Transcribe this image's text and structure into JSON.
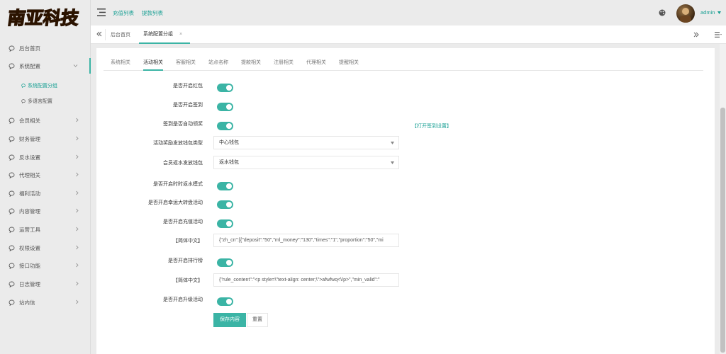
{
  "brand": {
    "logo_text": "南亚科技"
  },
  "sidebar": {
    "items": [
      {
        "label": "后台首页",
        "icon": "chat-bubble-icon"
      },
      {
        "label": "系统配置",
        "icon": "chat-bubble-icon"
      },
      {
        "label": "会员相关",
        "icon": "chat-bubble-icon"
      },
      {
        "label": "财务管理",
        "icon": "chat-bubble-icon"
      },
      {
        "label": "反水设置",
        "icon": "chat-bubble-icon"
      },
      {
        "label": "代理相关",
        "icon": "chat-bubble-icon"
      },
      {
        "label": "福利活动",
        "icon": "chat-bubble-icon"
      },
      {
        "label": "内容管理",
        "icon": "chat-bubble-icon"
      },
      {
        "label": "运营工具",
        "icon": "chat-bubble-icon"
      },
      {
        "label": "权限设置",
        "icon": "chat-bubble-icon"
      },
      {
        "label": "接口功能",
        "icon": "chat-bubble-icon"
      },
      {
        "label": "日志管理",
        "icon": "chat-bubble-icon"
      },
      {
        "label": "站内信",
        "icon": "chat-bubble-icon"
      }
    ],
    "sub_items": [
      {
        "label": "系统配置分组",
        "current": true
      },
      {
        "label": "多语言配置",
        "current": false
      }
    ]
  },
  "topbar": {
    "links": [
      "充值列表",
      "提款列表"
    ],
    "user_name": "admin"
  },
  "page_tabs": {
    "items": [
      {
        "label": "后台首页"
      },
      {
        "label": "系统配置分组",
        "close": "×"
      }
    ]
  },
  "subtabs": {
    "items": [
      "系统相关",
      "活动相关",
      "客服相关",
      "站点名称",
      "提款相关",
      "注册相关",
      "代理相关",
      "提醒相关"
    ],
    "active_index": 1
  },
  "form": {
    "rows": [
      {
        "label": "是否开启红包",
        "type": "toggle",
        "on": true
      },
      {
        "label": "是否开启签到",
        "type": "toggle",
        "on": true
      },
      {
        "label": "签到是否自动领奖",
        "type": "toggle",
        "on": true,
        "extra_link": "【打开签到设置】"
      },
      {
        "label": "活动奖励发放钱包类型",
        "type": "select",
        "value": "中心钱包"
      },
      {
        "label": "会员返水发放钱包",
        "type": "select",
        "value": "返水钱包"
      },
      {
        "label": "是否开启时时返水模式",
        "type": "toggle",
        "on": true
      },
      {
        "label": "是否开启幸运大转盘活动",
        "type": "toggle",
        "on": true
      },
      {
        "label": "是否开启充值活动",
        "type": "toggle",
        "on": true
      },
      {
        "label": "【简体中文】",
        "type": "text",
        "value": "{\"zh_cn\":[{\"deposit\":\"50\",\"ml_money\":\"130\",\"times\":\"1\",\"proportion\":\"50\",\"mi"
      },
      {
        "label": "是否开启排行榜",
        "type": "toggle",
        "on": true
      },
      {
        "label": "【简体中文】",
        "type": "text",
        "value": "{\"rule_content\":\"<p style=\\\"text-align: center;\\\">afwfwq<\\/p>\",\"min_valid\":\""
      },
      {
        "label": "是否开启升级活动",
        "type": "toggle",
        "on": true
      }
    ],
    "save_label": "保存内容",
    "reset_label": "重置"
  },
  "colors": {
    "accent": "#3bb4a5",
    "link": "#1aa094"
  }
}
